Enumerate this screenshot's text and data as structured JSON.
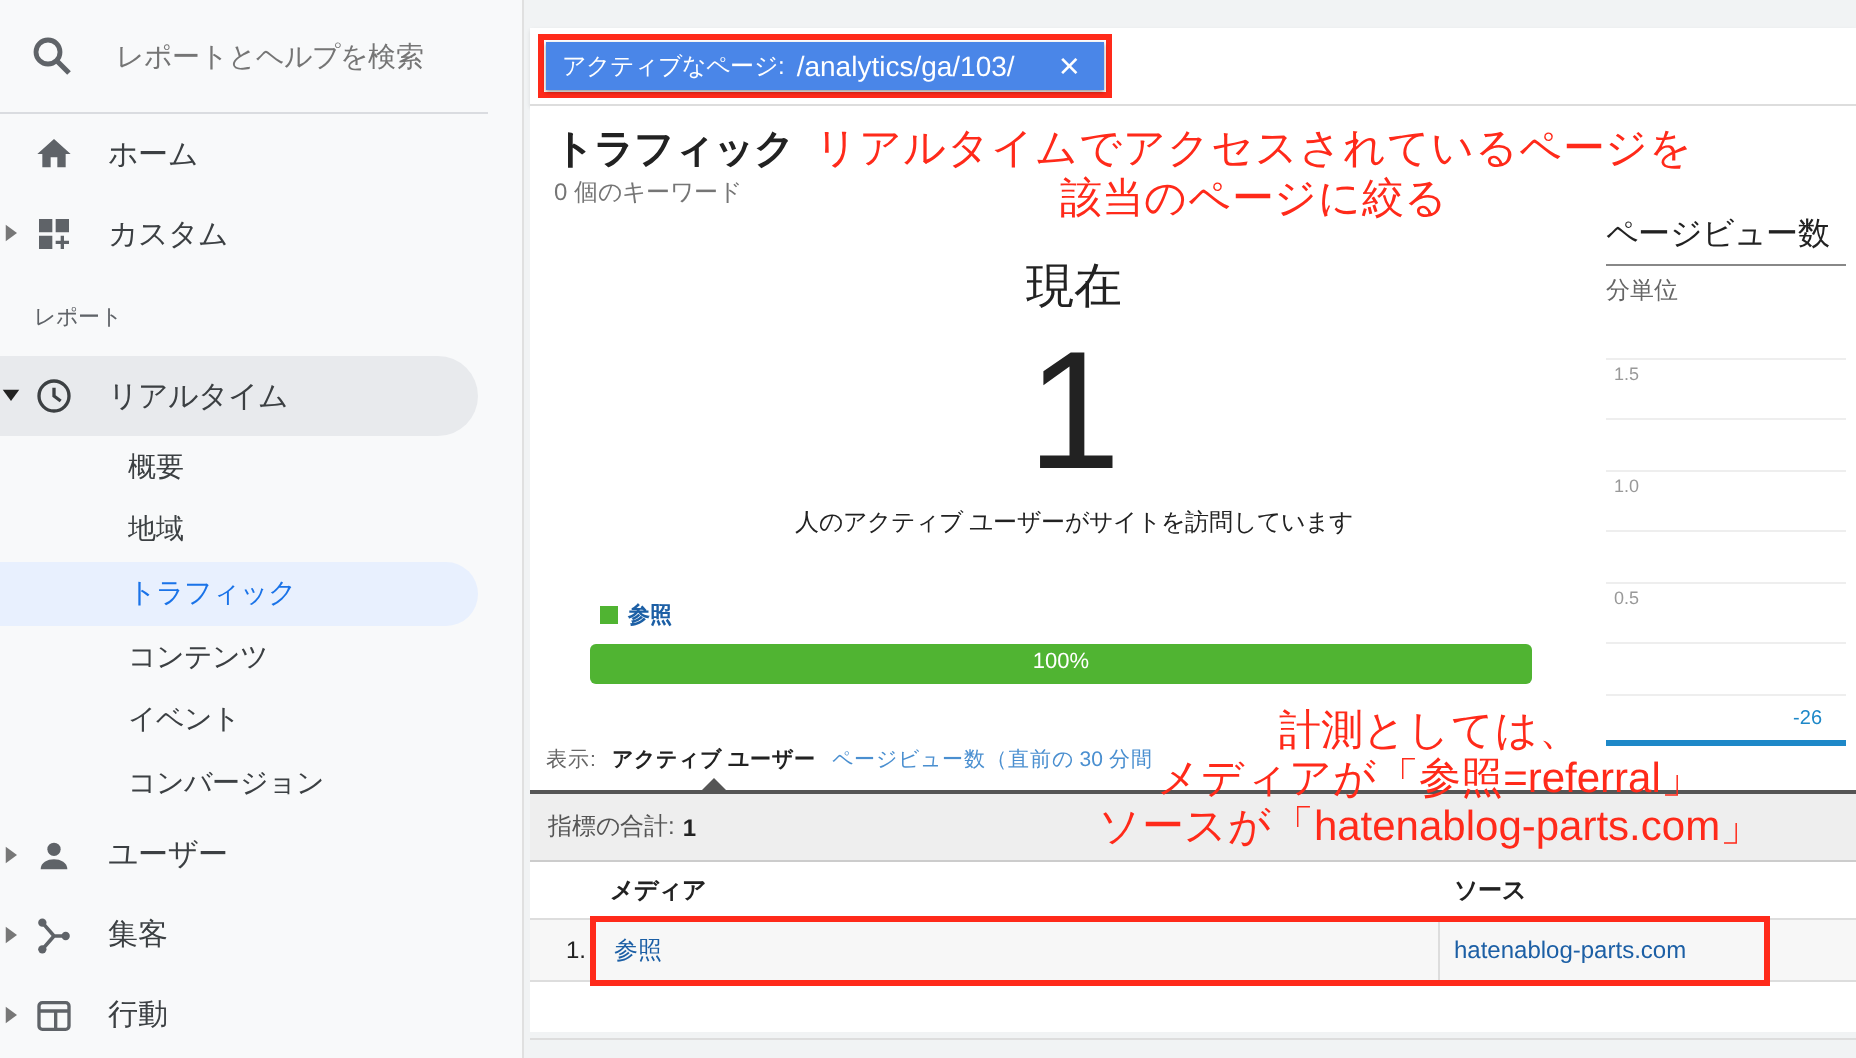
{
  "sidebar": {
    "search": {
      "placeholder": "レポートとヘルプを検索"
    },
    "top_items": [
      {
        "label": "ホーム",
        "selected": false
      },
      {
        "label": "カスタム",
        "expanded": false,
        "selected": false
      }
    ],
    "section_label": "レポート",
    "report_items": [
      {
        "label": "リアルタイム",
        "expanded": true,
        "selected": true,
        "children": [
          {
            "label": "概要",
            "selected": false
          },
          {
            "label": "地域",
            "selected": false
          },
          {
            "label": "トラフィック",
            "selected": true
          },
          {
            "label": "コンテンツ",
            "selected": false
          },
          {
            "label": "イベント",
            "selected": false
          },
          {
            "label": "コンバージョン",
            "selected": false
          }
        ]
      },
      {
        "label": "ユーザー",
        "expanded": false,
        "selected": false
      },
      {
        "label": "集客",
        "expanded": false,
        "selected": false
      },
      {
        "label": "行動",
        "expanded": false,
        "selected": false
      }
    ]
  },
  "filter": {
    "label": "アクティブなページ:",
    "value": "/analytics/ga/103/",
    "remove": "×",
    "highlighted": true
  },
  "overview": {
    "title": "トラフィック",
    "subtitle": "0 個のキーワード",
    "now_label": "現在",
    "count": "1",
    "caption": "人のアクティブ ユーザーがサイトを訪問しています",
    "legend": [
      {
        "label": "参照",
        "color": "#50b432"
      }
    ],
    "bar": {
      "level": 1,
      "label": "100%"
    }
  },
  "chart": {
    "title": "ページビュー数",
    "unit": "分単位",
    "y_ticks": [
      "1.5",
      "1.0",
      "0.5"
    ],
    "x_tick": "-26"
  },
  "view_toggle": {
    "label": "表示:",
    "options": [
      {
        "label": "アクティブ ユーザー",
        "selected": true
      },
      {
        "label": "ページビュー数（直前の 30 分間",
        "selected": false
      }
    ]
  },
  "table": {
    "total_label": "指標の合計:",
    "total": "1",
    "columns": [
      "メディア",
      "ソース"
    ],
    "rows": [
      {
        "index": "1.",
        "cells": [
          "参照",
          "hatenablog-parts.com"
        ],
        "highlighted": true
      }
    ]
  },
  "annotations": [
    {
      "lines": [
        "リアルタイムでアクセスされているページを",
        "該当のページに絞る"
      ]
    },
    {
      "lines": [
        "計測としては、",
        "メディアが「参照=referral」",
        "ソースが「hatenablog-parts.com」"
      ]
    }
  ]
}
